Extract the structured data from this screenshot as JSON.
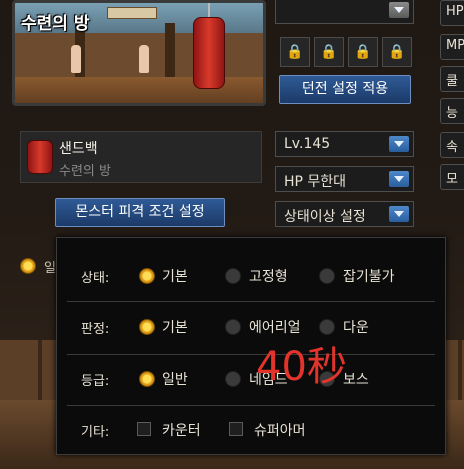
{
  "preview": {
    "title": "수련의 방"
  },
  "right_panel": {
    "top_dropdown_value": "",
    "apply_button_label": "던전 설정 적용",
    "level_value": "Lv.145",
    "hp_value": "HP 무한대",
    "status_dropdown_label": "상태이상 설정"
  },
  "side_tabs": [
    "HP",
    "MP",
    "쿨",
    "능",
    "속",
    "모"
  ],
  "monster": {
    "name": "샌드백",
    "map": "수련의 방",
    "condition_button_label": "몬스터 피격 조건 설정"
  },
  "background_row": {
    "option_label": "일반"
  },
  "popup": {
    "state": {
      "label": "상태:",
      "options": [
        "기본",
        "고정형",
        "잡기불가"
      ],
      "selected": "기본"
    },
    "judge": {
      "label": "판정:",
      "options": [
        "기본",
        "에어리얼",
        "다운"
      ],
      "selected": "기본"
    },
    "grade": {
      "label": "등급:",
      "options": [
        "일반",
        "네임드",
        "보스"
      ],
      "selected": "일반"
    },
    "etc": {
      "label": "기타:",
      "options": [
        "카운터",
        "슈퍼아머"
      ],
      "checked": []
    }
  },
  "overlay": {
    "text": "40秒",
    "color": "#e3342c"
  },
  "colors": {
    "accent_blue": "#2f5a96",
    "radio_selected": "#e6a51a",
    "panel_bg": "#0b0b0b"
  }
}
